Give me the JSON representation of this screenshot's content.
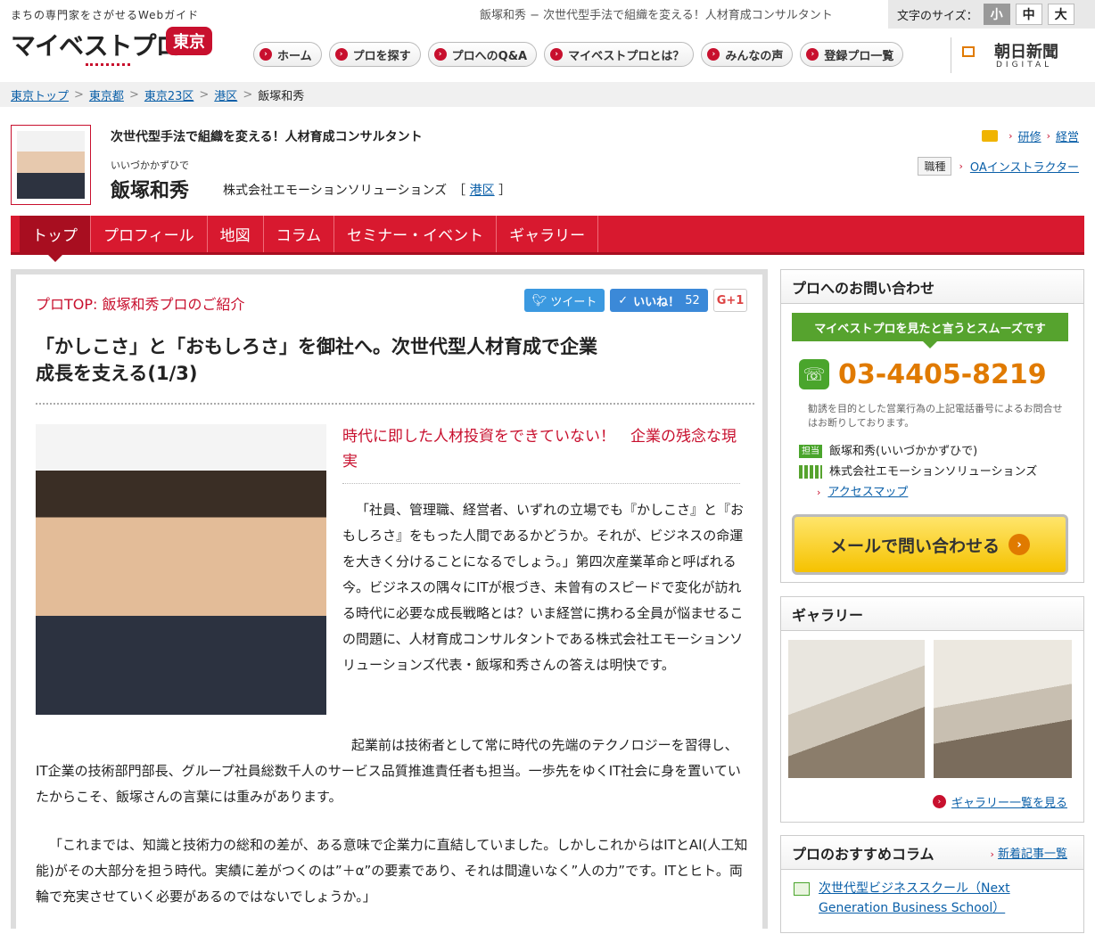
{
  "header": {
    "tagline": "まちの専門家をさがせるWebガイド",
    "logo": "マイベストプロ",
    "city": "東京",
    "page_title": "飯塚和秀 − 次世代型手法で組織を変える！人材育成コンサルタント",
    "fontsize_label": "文字のサイズ：",
    "fontsize_options": [
      "小",
      "中",
      "大"
    ],
    "nav": [
      "ホーム",
      "プロを探す",
      "プロへのQ&A",
      "マイベストプロとは？",
      "みんなの声",
      "登録プロ一覧"
    ],
    "partner_name": "朝日新聞",
    "partner_sub": "DIGITAL"
  },
  "breadcrumb": [
    "東京トップ",
    "東京都",
    "東京23区",
    "港区",
    "飯塚和秀"
  ],
  "profile": {
    "catch": "次世代型手法で組織を変える！人材育成コンサルタント",
    "kana": "いいづかかずひで",
    "name": "飯塚和秀",
    "company": "株式会社エモーションソリューションズ",
    "area": "港区",
    "tags": [
      "研修",
      "経営"
    ],
    "job_label": "職種",
    "job": "OAインストラクター"
  },
  "tabs": [
    "トップ",
    "プロフィール",
    "地図",
    "コラム",
    "セミナー・イベント",
    "ギャラリー"
  ],
  "article": {
    "lead": "プロTOP: 飯塚和秀プロのご紹介",
    "tweet": "ツイート",
    "like": "いいね！",
    "like_count": "52",
    "gplus": "G+1",
    "title": "「かしこさ」と「おもしろさ」を御社へ。次世代型人材育成で企業成長を支える(1/3)",
    "subheading": "時代に即した人材投資をできていない！　企業の残念な現実",
    "para1": "「社員、管理職、経営者、いずれの立場でも『かしこさ』と『おもしろさ』をもった人間であるかどうか。それが、ビジネスの命運を大きく分けることになるでしょう。」第四次産業革命と呼ばれる今。ビジネスの隅々にITが根づき、未曾有のスピードで変化が訪れる時代に必要な成長戦略とは？いま経営に携わる全員が悩ませるこの問題に、人材育成コンサルタントである株式会社エモーションソリューションズ代表・飯塚和秀さんの答えは明快です。",
    "para2": "起業前は技術者として常に時代の先端のテクノロジーを習得し、IT企業の技術部門部長、グループ社員総数千人のサービス品質推進責任者も担当。一歩先をゆくIT社会に身を置いていたからこそ、飯塚さんの言葉には重みがあります。",
    "para3": "「これまでは、知識と技術力の総和の差が、ある意味で企業力に直結していました。しかしこれからはITとAI(人工知能)がその大部分を担う時代。実績に差がつくのは”＋α”の要素であり、それは間違いなく”人の力”です。ITとヒト。両輪で充実させていく必要があるのではないでしょうか。」"
  },
  "contact": {
    "heading": "プロへのお問い合わせ",
    "banner": "マイベストプロを見たと言うとスムーズです",
    "phone": "03-4405-8219",
    "note": "勧誘を目的とした営業行為の上記電話番号によるお問合せはお断りしております。",
    "rep_badge": "担当",
    "rep": "飯塚和秀(いいづかかずひで)",
    "company": "株式会社エモーションソリューションズ",
    "map_link": "アクセスマップ",
    "mail_button": "メールで問い合わせる"
  },
  "gallery": {
    "heading": "ギャラリー",
    "more": "ギャラリー一覧を見る"
  },
  "columns": {
    "heading": "プロのおすすめコラム",
    "new_link": "新着記事一覧",
    "item": "次世代型ビジネススクール（Next Generation Business School）"
  }
}
